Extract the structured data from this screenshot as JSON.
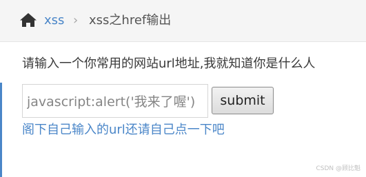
{
  "breadcrumb": {
    "home_icon": "home-icon",
    "link_label": "xss",
    "separator": "›",
    "current_label": "xss之href输出"
  },
  "main": {
    "prompt": "请输入一个你常用的网站url地址,我就知道你是什么人",
    "input_value": "javascript:alert('我来了喔')",
    "submit_label": "submit",
    "result_link": "阁下自己输入的url还请自己点一下吧"
  },
  "watermark": "CSDN @顾比魁",
  "colors": {
    "link": "#4a86c8",
    "breadcrumb_bg": "#f5f5f5",
    "text": "#393939"
  }
}
